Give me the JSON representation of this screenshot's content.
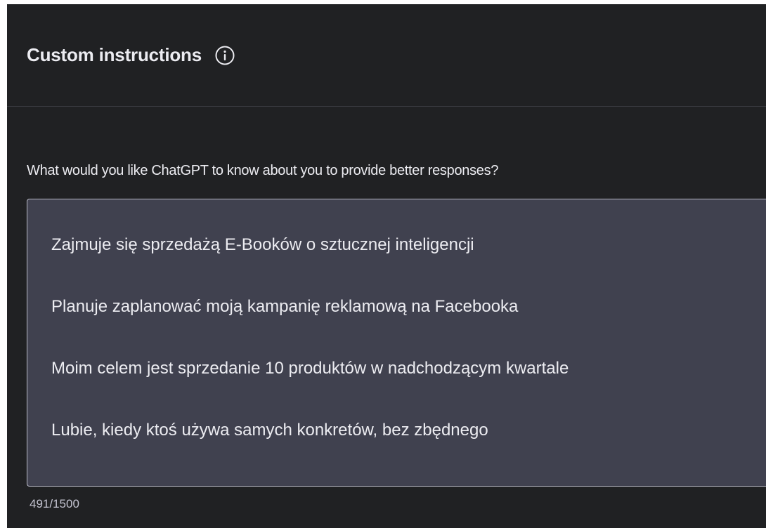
{
  "modal": {
    "title": "Custom instructions",
    "info_icon": "info-circle-icon"
  },
  "about_user": {
    "question": "What would you like ChatGPT to know about you to provide better responses?",
    "value": "Zajmuje się sprzedażą E-Booków o sztucznej inteligencji\n\nPlanuje zaplanować moją kampanię reklamową na Facebooka\n\nMoim celem jest sprzedanie 10 produktów w nadchodzącym kwartale\n\nLubie, kiedy ktoś używa samych konkretów, bez zbędnego",
    "counter": "491/1500"
  },
  "colors": {
    "background": "#202123",
    "textarea": "#40414f",
    "text": "#ececf1"
  }
}
